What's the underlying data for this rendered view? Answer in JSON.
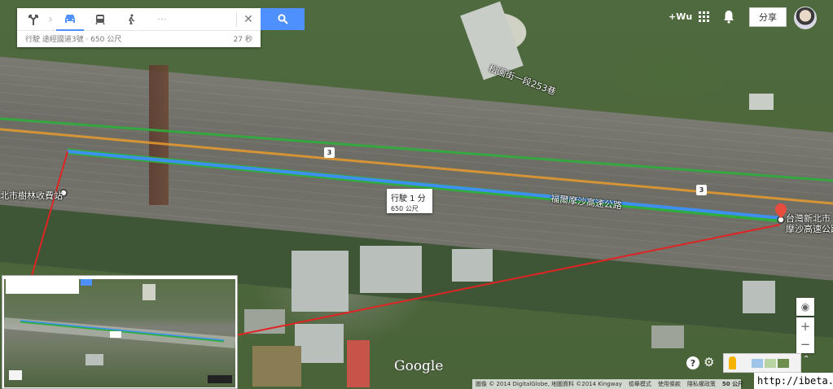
{
  "directions": {
    "modes": [
      {
        "name": "driving",
        "icon": "car-icon",
        "active": true
      },
      {
        "name": "transit",
        "icon": "train-icon",
        "active": false
      },
      {
        "name": "walking",
        "icon": "walk-icon",
        "active": false
      },
      {
        "name": "more",
        "icon": "more-icon",
        "active": false
      }
    ],
    "summary": "行駛 途經國道3號 · 650 公尺",
    "time": "27 秒"
  },
  "header": {
    "plus_user": "+Wu",
    "share_label": "分享"
  },
  "map_labels": {
    "street": "松園街一段253巷",
    "toll_station": "北市樹林收費站",
    "highway": "福爾摩沙高速公路",
    "destination_line1": "台灣新北市",
    "destination_line2": "摩沙高速公路",
    "route_shield": "3"
  },
  "tooltip": {
    "line1": "行駛 1 分",
    "line2": "650 公尺"
  },
  "controls": {
    "zoom_in": "+",
    "zoom_out": "−",
    "help": "?",
    "gear": "⚙"
  },
  "footer": {
    "google_logo": "Google",
    "imagery": "圖像 © 2014 DigitalGlobe, 地圖資料 ©2014 Kingway",
    "report": "檢舉模式",
    "terms": "使用條款",
    "privacy": "隱私權政策",
    "scale": "50 公尺"
  },
  "watermark": "http://ibeta.tw",
  "colors": {
    "route_blue": "#3f8ff0",
    "route_green": "#2fae3c",
    "route_orange": "#e79a2c",
    "connector_red": "#e02424",
    "accent": "#4d90fe"
  }
}
